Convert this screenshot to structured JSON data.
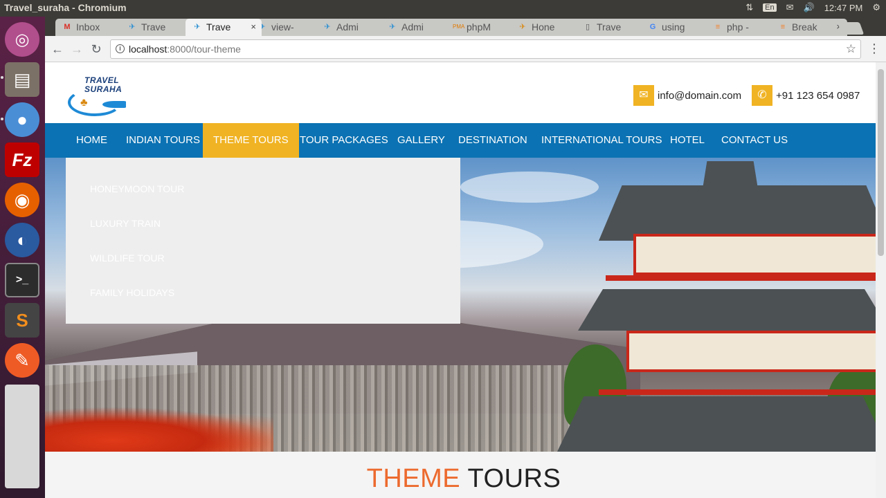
{
  "os": {
    "window_title": "Travel_suraha - Chromium",
    "keyboard_layout": "En",
    "clock": "12:47 PM"
  },
  "browser": {
    "tabs": [
      {
        "label": "Inbox",
        "icon": "gmail-icon"
      },
      {
        "label": "Trave",
        "icon": "site-icon"
      },
      {
        "label": "Trave",
        "icon": "site-icon",
        "active": true
      },
      {
        "label": "view-",
        "icon": "site-icon"
      },
      {
        "label": "Admi",
        "icon": "site-icon"
      },
      {
        "label": "Admi",
        "icon": "site-icon"
      },
      {
        "label": "phpM",
        "icon": "phpmyadmin-icon"
      },
      {
        "label": "Hone",
        "icon": "site-icon"
      },
      {
        "label": "Trave",
        "icon": "page-icon"
      },
      {
        "label": "using",
        "icon": "google-icon"
      },
      {
        "label": "php -",
        "icon": "stackoverflow-icon"
      },
      {
        "label": "Break",
        "icon": "stackoverflow-icon"
      }
    ],
    "url_host": "localhost",
    "url_path": ":8000/tour-theme"
  },
  "site": {
    "logo_line1": "TRAVEL",
    "logo_line2": "SURAHA",
    "email": "info@domain.com",
    "phone": "+91 123 654 0987",
    "nav": [
      {
        "label": "HOME"
      },
      {
        "label": "INDIAN TOURS"
      },
      {
        "label": "THEME TOURS",
        "active": true
      },
      {
        "label": "TOUR PACKAGES"
      },
      {
        "label": "GALLERY"
      },
      {
        "label": "DESTINATION"
      },
      {
        "label": "INTERNATIONAL TOURS"
      },
      {
        "label": "HOTEL"
      },
      {
        "label": "CONTACT US"
      }
    ],
    "dropdown": [
      "HONEYMOON TOUR",
      "LUXURY TRAIN",
      "WILDLIFE TOUR",
      "FAMILY HOLIDAYS"
    ],
    "section_title_1": "THEME",
    "section_title_2": "TOURS"
  },
  "colors": {
    "nav_bg": "#0b72b3",
    "accent": "#f0b323",
    "title_accent": "#ec6a2e"
  }
}
